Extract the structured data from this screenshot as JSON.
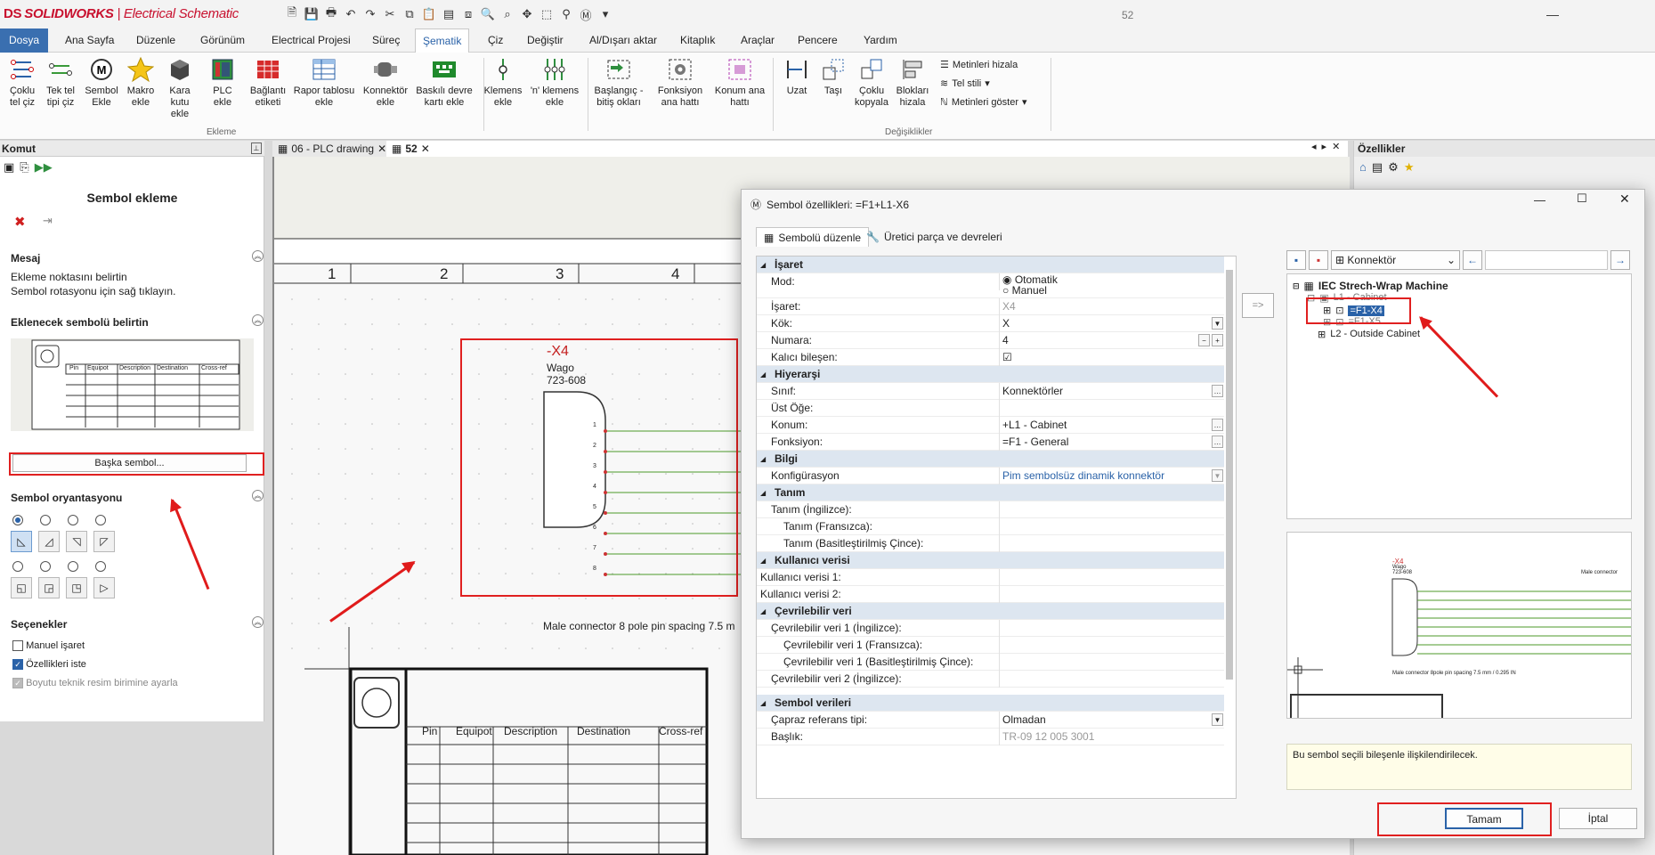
{
  "app": {
    "brand_ds": "DS",
    "brand": "SOLIDWORKS",
    "product": "| Electrical Schematic",
    "window_title": "52"
  },
  "menu": [
    "Dosya",
    "Ana Sayfa",
    "Düzenle",
    "Görünüm",
    "Electrical Projesi",
    "Süreç",
    "Şematik",
    "Çiz",
    "Değiştir",
    "Al/Dışarı aktar",
    "Kitaplık",
    "Araçlar",
    "Pencere",
    "Yardım"
  ],
  "ribbon": {
    "buttons": [
      "Çoklu tel çiz",
      "Tek tel tipi çiz",
      "Sembol Ekle",
      "Makro ekle",
      "Kara kutu ekle",
      "PLC ekle",
      "Bağlantı etiketi",
      "Rapor tablosu ekle",
      "Konnektör ekle",
      "Baskılı devre kartı ekle",
      "Klemens ekle",
      "'n' klemens ekle",
      "Başlangıç - bitiş okları",
      "Fonksiyon ana hattı",
      "Konum ana hattı",
      "Uzat",
      "Taşı",
      "Çoklu kopyala",
      "Blokları hizala"
    ],
    "small": [
      "Metinleri hizala",
      "Tel stili",
      "Metinleri göster"
    ],
    "group_ekleme": "Ekleme",
    "group_degisiklikler": "Değişiklikler"
  },
  "left": {
    "header": "Komut",
    "title": "Sembol ekleme",
    "mesaj_title": "Mesaj",
    "mesaj_1": "Ekleme noktasını belirtin",
    "mesaj_2": "Sembol rotasyonu için sağ tıklayın.",
    "eklenecek_title": "Eklenecek sembolü belirtin",
    "baska_button": "Başka sembol...",
    "oryantasyon_title": "Sembol oryantasyonu",
    "secenekler_title": "Seçenekler",
    "opt_manuel": "Manuel işaret",
    "opt_ozellikler": "Özellikleri iste",
    "opt_boyut": "Boyutu teknik resim birimine ayarla",
    "thumb_cols": [
      "Pin",
      "Equipot",
      "Description",
      "Destination",
      "Cross-ref"
    ]
  },
  "doc": {
    "tab1": "06 - PLC drawing",
    "tab2": "52",
    "grid": [
      "1",
      "2",
      "3",
      "4"
    ],
    "sym_tag": "-X4",
    "sym_maker": "Wago",
    "sym_part": "723-608",
    "pins": [
      "1",
      "2",
      "3",
      "4",
      "5",
      "6",
      "7",
      "8"
    ],
    "sym_desc": "Male connector 8 pole pin spacing 7.5 m",
    "table_cols": [
      "Pin",
      "Equipot",
      "Description",
      "Destination",
      "Cross-ref"
    ]
  },
  "props": {
    "title": "Özellikler"
  },
  "dialog": {
    "title": "Sembol özellikleri: =F1+L1-X6",
    "tab1": "Sembolü düzenle",
    "tab2": "Üretici parça ve devreleri",
    "rows": [
      {
        "t": "cat",
        "l": "İşaret"
      },
      {
        "l": "Mod:",
        "v": "Otomatik",
        "v2": "Manuel"
      },
      {
        "l": "İşaret:",
        "v": "X4",
        "dim": true
      },
      {
        "l": "Kök:",
        "v": "X",
        "dd": true
      },
      {
        "l": "Numara:",
        "v": "4",
        "spin": true
      },
      {
        "l": "Kalıcı bileşen:",
        "v": "",
        "check": true
      },
      {
        "t": "cat",
        "l": "Hiyerarşi"
      },
      {
        "l": "Sınıf:",
        "v": "Konnektörler",
        "dots": true
      },
      {
        "l": "Üst Öğe:",
        "v": ""
      },
      {
        "l": "Konum:",
        "v": "+L1 - Cabinet",
        "dots": true
      },
      {
        "l": "Fonksiyon:",
        "v": "=F1 - General",
        "dots": true
      },
      {
        "t": "cat",
        "l": "Bilgi"
      },
      {
        "l": "Konfigürasyon",
        "v": "Pim sembolsüz dinamik konnektör",
        "dd": true,
        "dim": true
      },
      {
        "t": "cat",
        "l": "Tanım"
      },
      {
        "l": "Tanım (İngilizce):",
        "v": ""
      },
      {
        "l": "Tanım (Fransızca):",
        "v": "",
        "indent": true
      },
      {
        "l": "Tanım (Basitleştirilmiş Çince):",
        "v": "",
        "indent": true
      },
      {
        "t": "cat",
        "l": "Kullanıcı verisi"
      },
      {
        "l": "Kullanıcı verisi 1:",
        "v": "",
        "noicon": true
      },
      {
        "l": "Kullanıcı verisi 2:",
        "v": "",
        "noicon": true
      },
      {
        "t": "cat",
        "l": "Çevrilebilir veri"
      },
      {
        "l": "Çevrilebilir veri 1 (İngilizce):",
        "v": ""
      },
      {
        "l": "Çevrilebilir veri 1 (Fransızca):",
        "v": "",
        "indent": true
      },
      {
        "l": "Çevrilebilir veri 1 (Basitleştirilmiş Çince):",
        "v": "",
        "indent": true
      },
      {
        "l": "Çevrilebilir veri 2 (İngilizce):",
        "v": ""
      },
      {
        "t": "gap"
      },
      {
        "t": "cat",
        "l": "Sembol verileri"
      },
      {
        "l": "Çapraz referans tipi:",
        "v": "Olmadan",
        "dd": true
      },
      {
        "l": "Başlık:",
        "v": "TR-09 12 005 3001",
        "dim": true
      }
    ],
    "connector_select": "Konnektör",
    "tree_root": "IEC Strech-Wrap Machine",
    "tree_l1": "L1 - Cabinet",
    "tree_sel": "=F1-X4",
    "tree_x5": "=F1-X5",
    "tree_l2": "L2 - Outside Cabinet",
    "assoc_arrow": "=>",
    "preview_tag": "-X4",
    "preview_maker": "Wago",
    "preview_part": "723-608",
    "preview_right": "Male connector",
    "preview_desc": "Male connector 8pole pin spacing 7.5 mm / 0.295 IN",
    "message": "Bu sembol seçili bileşenle ilişkilendirilecek.",
    "ok": "Tamam",
    "cancel": "İptal"
  },
  "colors": {
    "accent": "#2a62a8",
    "red": "#e02020",
    "wire": "#4c9a2a",
    "brand": "#c8102e"
  }
}
